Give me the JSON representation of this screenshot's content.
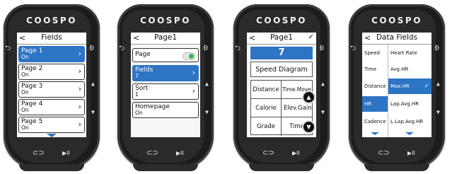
{
  "brand": "COOSPO",
  "side_icons": {
    "back": "⮌",
    "page": "⟨D⟩",
    "up": "▲",
    "down": "▼",
    "lap": "⟳",
    "play": "▶II"
  },
  "screen1": {
    "title": "Fields",
    "back": "<",
    "rows": [
      {
        "label": "Page 1",
        "value": "On",
        "selected": true
      },
      {
        "label": "Page 2",
        "value": "On"
      },
      {
        "label": "Page 3",
        "value": "On"
      },
      {
        "label": "Page 4",
        "value": "On"
      },
      {
        "label": "Page 5",
        "value": "On"
      }
    ]
  },
  "screen2": {
    "title": "Page1",
    "back": "<",
    "rows": [
      {
        "label": "Page",
        "value": ""
      },
      {
        "label": "Fields",
        "value": "7",
        "selected": true
      },
      {
        "label": "Sort",
        "value": "1"
      },
      {
        "label": "Homepage",
        "value": "On"
      }
    ],
    "toggle_on": true
  },
  "screen3": {
    "title": "Page1",
    "back": "<",
    "check": "✓",
    "count": "7",
    "speed": "Speed Diagram",
    "cells": [
      [
        "Distance",
        "Time.Move"
      ],
      [
        "Calorie",
        "Elev.Gain"
      ],
      [
        "Grade",
        "Time"
      ]
    ]
  },
  "screen4": {
    "title": "Data Fields",
    "back": "<",
    "left": [
      {
        "label": "Speed"
      },
      {
        "label": "Time"
      },
      {
        "label": "Distance"
      },
      {
        "label": "HR",
        "selected": true
      },
      {
        "label": "Cadence"
      }
    ],
    "right": [
      {
        "label": "Heart Rate"
      },
      {
        "label": "Avg.HR"
      },
      {
        "label": "Max.HR",
        "selected": true
      },
      {
        "label": "Lap.Avg.HR"
      },
      {
        "label": "L.Lap.Avg.HR"
      }
    ],
    "check": "✓"
  },
  "colors": {
    "accent": "#2e74c4",
    "toggle": "#2fbf4a",
    "shell": "#1c1c1c"
  }
}
